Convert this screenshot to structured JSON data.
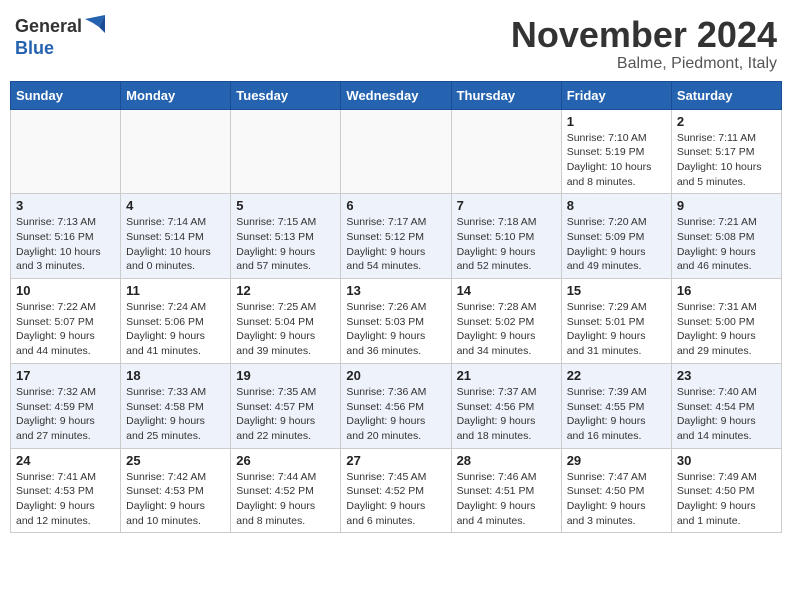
{
  "header": {
    "logo_general": "General",
    "logo_blue": "Blue",
    "month_title": "November 2024",
    "location": "Balme, Piedmont, Italy"
  },
  "weekdays": [
    "Sunday",
    "Monday",
    "Tuesday",
    "Wednesday",
    "Thursday",
    "Friday",
    "Saturday"
  ],
  "weeks": [
    [
      {
        "day": "",
        "info": ""
      },
      {
        "day": "",
        "info": ""
      },
      {
        "day": "",
        "info": ""
      },
      {
        "day": "",
        "info": ""
      },
      {
        "day": "",
        "info": ""
      },
      {
        "day": "1",
        "info": "Sunrise: 7:10 AM\nSunset: 5:19 PM\nDaylight: 10 hours\nand 8 minutes."
      },
      {
        "day": "2",
        "info": "Sunrise: 7:11 AM\nSunset: 5:17 PM\nDaylight: 10 hours\nand 5 minutes."
      }
    ],
    [
      {
        "day": "3",
        "info": "Sunrise: 7:13 AM\nSunset: 5:16 PM\nDaylight: 10 hours\nand 3 minutes."
      },
      {
        "day": "4",
        "info": "Sunrise: 7:14 AM\nSunset: 5:14 PM\nDaylight: 10 hours\nand 0 minutes."
      },
      {
        "day": "5",
        "info": "Sunrise: 7:15 AM\nSunset: 5:13 PM\nDaylight: 9 hours\nand 57 minutes."
      },
      {
        "day": "6",
        "info": "Sunrise: 7:17 AM\nSunset: 5:12 PM\nDaylight: 9 hours\nand 54 minutes."
      },
      {
        "day": "7",
        "info": "Sunrise: 7:18 AM\nSunset: 5:10 PM\nDaylight: 9 hours\nand 52 minutes."
      },
      {
        "day": "8",
        "info": "Sunrise: 7:20 AM\nSunset: 5:09 PM\nDaylight: 9 hours\nand 49 minutes."
      },
      {
        "day": "9",
        "info": "Sunrise: 7:21 AM\nSunset: 5:08 PM\nDaylight: 9 hours\nand 46 minutes."
      }
    ],
    [
      {
        "day": "10",
        "info": "Sunrise: 7:22 AM\nSunset: 5:07 PM\nDaylight: 9 hours\nand 44 minutes."
      },
      {
        "day": "11",
        "info": "Sunrise: 7:24 AM\nSunset: 5:06 PM\nDaylight: 9 hours\nand 41 minutes."
      },
      {
        "day": "12",
        "info": "Sunrise: 7:25 AM\nSunset: 5:04 PM\nDaylight: 9 hours\nand 39 minutes."
      },
      {
        "day": "13",
        "info": "Sunrise: 7:26 AM\nSunset: 5:03 PM\nDaylight: 9 hours\nand 36 minutes."
      },
      {
        "day": "14",
        "info": "Sunrise: 7:28 AM\nSunset: 5:02 PM\nDaylight: 9 hours\nand 34 minutes."
      },
      {
        "day": "15",
        "info": "Sunrise: 7:29 AM\nSunset: 5:01 PM\nDaylight: 9 hours\nand 31 minutes."
      },
      {
        "day": "16",
        "info": "Sunrise: 7:31 AM\nSunset: 5:00 PM\nDaylight: 9 hours\nand 29 minutes."
      }
    ],
    [
      {
        "day": "17",
        "info": "Sunrise: 7:32 AM\nSunset: 4:59 PM\nDaylight: 9 hours\nand 27 minutes."
      },
      {
        "day": "18",
        "info": "Sunrise: 7:33 AM\nSunset: 4:58 PM\nDaylight: 9 hours\nand 25 minutes."
      },
      {
        "day": "19",
        "info": "Sunrise: 7:35 AM\nSunset: 4:57 PM\nDaylight: 9 hours\nand 22 minutes."
      },
      {
        "day": "20",
        "info": "Sunrise: 7:36 AM\nSunset: 4:56 PM\nDaylight: 9 hours\nand 20 minutes."
      },
      {
        "day": "21",
        "info": "Sunrise: 7:37 AM\nSunset: 4:56 PM\nDaylight: 9 hours\nand 18 minutes."
      },
      {
        "day": "22",
        "info": "Sunrise: 7:39 AM\nSunset: 4:55 PM\nDaylight: 9 hours\nand 16 minutes."
      },
      {
        "day": "23",
        "info": "Sunrise: 7:40 AM\nSunset: 4:54 PM\nDaylight: 9 hours\nand 14 minutes."
      }
    ],
    [
      {
        "day": "24",
        "info": "Sunrise: 7:41 AM\nSunset: 4:53 PM\nDaylight: 9 hours\nand 12 minutes."
      },
      {
        "day": "25",
        "info": "Sunrise: 7:42 AM\nSunset: 4:53 PM\nDaylight: 9 hours\nand 10 minutes."
      },
      {
        "day": "26",
        "info": "Sunrise: 7:44 AM\nSunset: 4:52 PM\nDaylight: 9 hours\nand 8 minutes."
      },
      {
        "day": "27",
        "info": "Sunrise: 7:45 AM\nSunset: 4:52 PM\nDaylight: 9 hours\nand 6 minutes."
      },
      {
        "day": "28",
        "info": "Sunrise: 7:46 AM\nSunset: 4:51 PM\nDaylight: 9 hours\nand 4 minutes."
      },
      {
        "day": "29",
        "info": "Sunrise: 7:47 AM\nSunset: 4:50 PM\nDaylight: 9 hours\nand 3 minutes."
      },
      {
        "day": "30",
        "info": "Sunrise: 7:49 AM\nSunset: 4:50 PM\nDaylight: 9 hours\nand 1 minute."
      }
    ]
  ]
}
